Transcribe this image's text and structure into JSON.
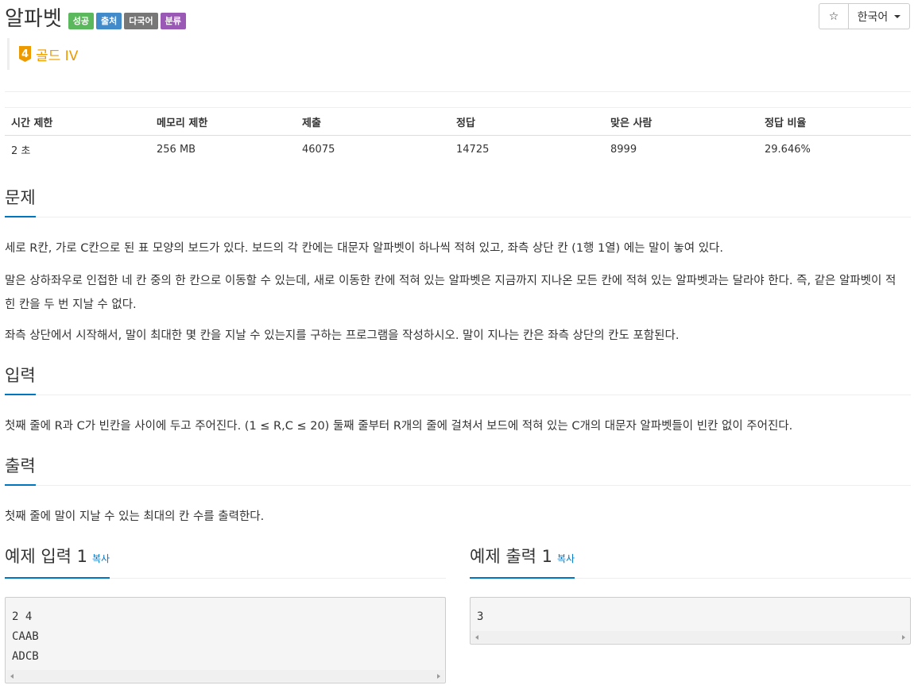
{
  "problem": {
    "title": "알파벳",
    "labels": [
      {
        "text": "성공",
        "color": "#5cb85c"
      },
      {
        "text": "출처",
        "color": "#428bca"
      },
      {
        "text": "다국어",
        "color": "#777777"
      },
      {
        "text": "분류",
        "color": "#9b59b6"
      }
    ],
    "tier_number": "4",
    "tier": "골드 IV"
  },
  "toolbar": {
    "star_icon": "☆",
    "language": "한국어"
  },
  "info": {
    "headers": [
      "시간 제한",
      "메모리 제한",
      "제출",
      "정답",
      "맞은 사람",
      "정답 비율"
    ],
    "values": [
      "2 초",
      "256 MB",
      "46075",
      "14725",
      "8999",
      "29.646%"
    ]
  },
  "sections": {
    "description": {
      "title": "문제",
      "paragraphs": [
        "세로 R칸, 가로 C칸으로 된 표 모양의 보드가 있다. 보드의 각 칸에는 대문자 알파벳이 하나씩 적혀 있고, 좌측 상단 칸 (1행 1열) 에는 말이 놓여 있다.",
        "말은 상하좌우로 인접한 네 칸 중의 한 칸으로 이동할 수 있는데, 새로 이동한 칸에 적혀 있는 알파벳은 지금까지 지나온 모든 칸에 적혀 있는 알파벳과는 달라야 한다. 즉, 같은 알파벳이 적힌 칸을 두 번 지날 수 없다.",
        "좌측 상단에서 시작해서, 말이 최대한 몇 칸을 지날 수 있는지를 구하는 프로그램을 작성하시오. 말이 지나는 칸은 좌측 상단의 칸도 포함된다."
      ]
    },
    "input": {
      "title": "입력",
      "text": "첫째 줄에 R과 C가 빈칸을 사이에 두고 주어진다. (1 ≤ R,C ≤ 20) 둘째 줄부터 R개의 줄에 걸쳐서 보드에 적혀 있는 C개의 대문자 알파벳들이 빈칸 없이 주어진다."
    },
    "output": {
      "title": "출력",
      "text": "첫째 줄에 말이 지날 수 있는 최대의 칸 수를 출력한다."
    }
  },
  "samples": {
    "input_title": "예제 입력 1",
    "output_title": "예제 출력 1",
    "copy_label": "복사",
    "input_lines": [
      "2 4",
      "CAAB",
      "ADCB"
    ],
    "output_lines": [
      "3"
    ]
  }
}
